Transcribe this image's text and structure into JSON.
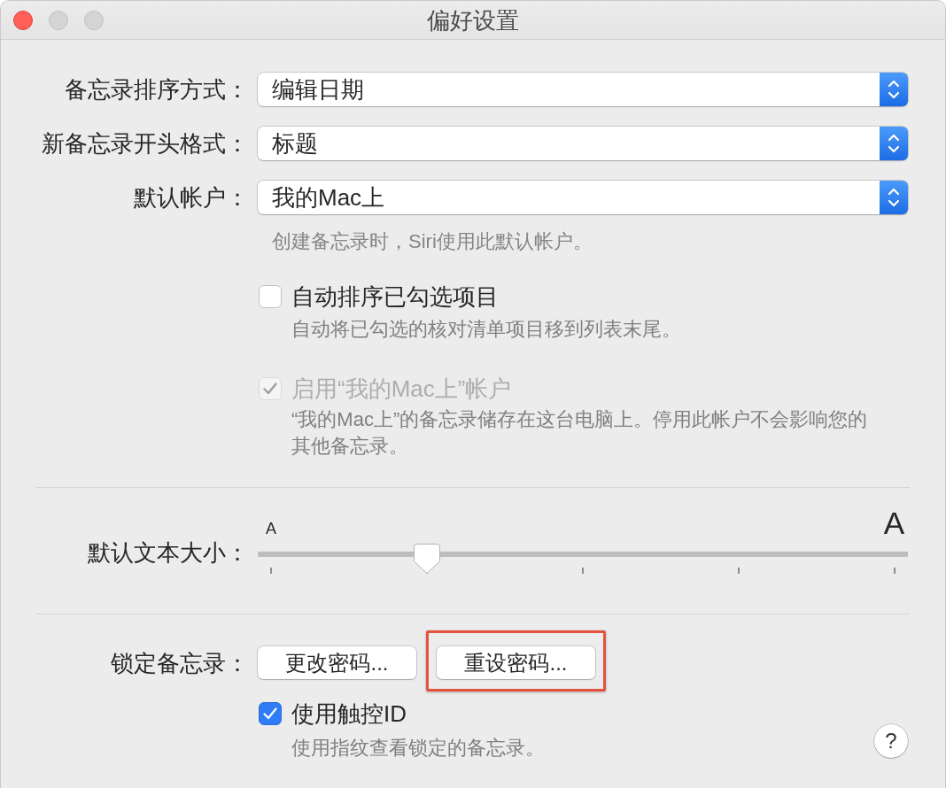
{
  "window": {
    "title": "偏好设置",
    "controls": [
      {
        "kind": "close",
        "disabled": false
      },
      {
        "kind": "minimize",
        "disabled": true
      },
      {
        "kind": "zoom",
        "disabled": true
      }
    ]
  },
  "popups": [
    {
      "label": "备忘录排序方式：",
      "value": "编辑日期"
    },
    {
      "label": "新备忘录开头格式：",
      "value": "标题"
    },
    {
      "label": "默认帐户：",
      "value": "我的Mac上"
    }
  ],
  "account_hint": "创建备忘录时，Siri使用此默认帐户。",
  "options": [
    {
      "label": "自动排序已勾选项目",
      "checked": false,
      "disabled": false,
      "description": "自动将已勾选的核对清单项目移到列表末尾。"
    },
    {
      "label": "启用“我的Mac上”帐户",
      "checked": true,
      "disabled": true,
      "description": "“我的Mac上”的备忘录储存在这台电脑上。停用此帐户不会影响您的其他备忘录。"
    }
  ],
  "text_size": {
    "label": "默认文本大小：",
    "min_label": "A",
    "max_label": "A",
    "level": 0.25
  },
  "lock": {
    "label": "锁定备忘录：",
    "buttons": [
      {
        "label": "更改密码...",
        "highlighted": false
      },
      {
        "label": "重设密码...",
        "highlighted": true
      }
    ],
    "touch_id": {
      "label": "使用触控ID",
      "checked": true,
      "disabled": false,
      "description": "使用指纹查看锁定的备忘录。"
    }
  },
  "help": {
    "label": "?"
  }
}
